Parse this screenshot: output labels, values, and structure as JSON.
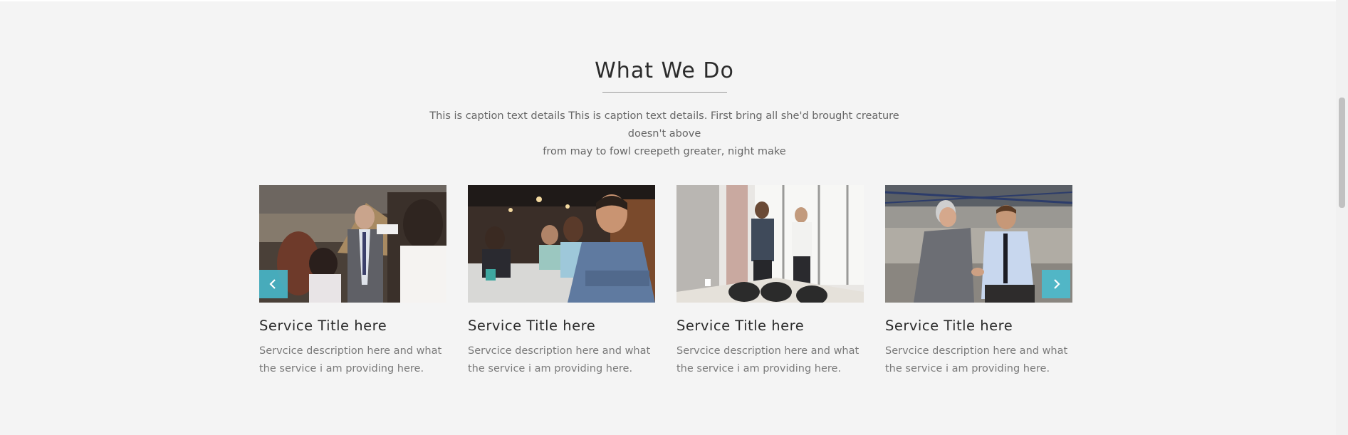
{
  "section": {
    "title": "What We Do",
    "caption_line1": "This is caption text details This is caption text details. First bring all she'd brought creature doesn't above",
    "caption_line2": "from may to fowl creepeth greater, night make"
  },
  "services": [
    {
      "title": "Service Title here",
      "description": "Servcice description here and what the service i am providing here.",
      "image": "business-presentation-photo"
    },
    {
      "title": "Service Title here",
      "description": "Servcice description here and what the service i am providing here.",
      "image": "smiling-businessman-photo"
    },
    {
      "title": "Service Title here",
      "description": "Servcice description here and what the service i am providing here.",
      "image": "office-handshake-photo"
    },
    {
      "title": "Service Title here",
      "description": "Servcice description here and what the service i am providing here.",
      "image": "business-handshake-photo"
    }
  ],
  "carousel": {
    "prev_icon": "chevron-left-icon",
    "next_icon": "chevron-right-icon",
    "accent_color": "#46bed2"
  },
  "colors": {
    "background": "#f4f4f4",
    "heading": "#2b2b2b",
    "body_text": "#666666"
  }
}
